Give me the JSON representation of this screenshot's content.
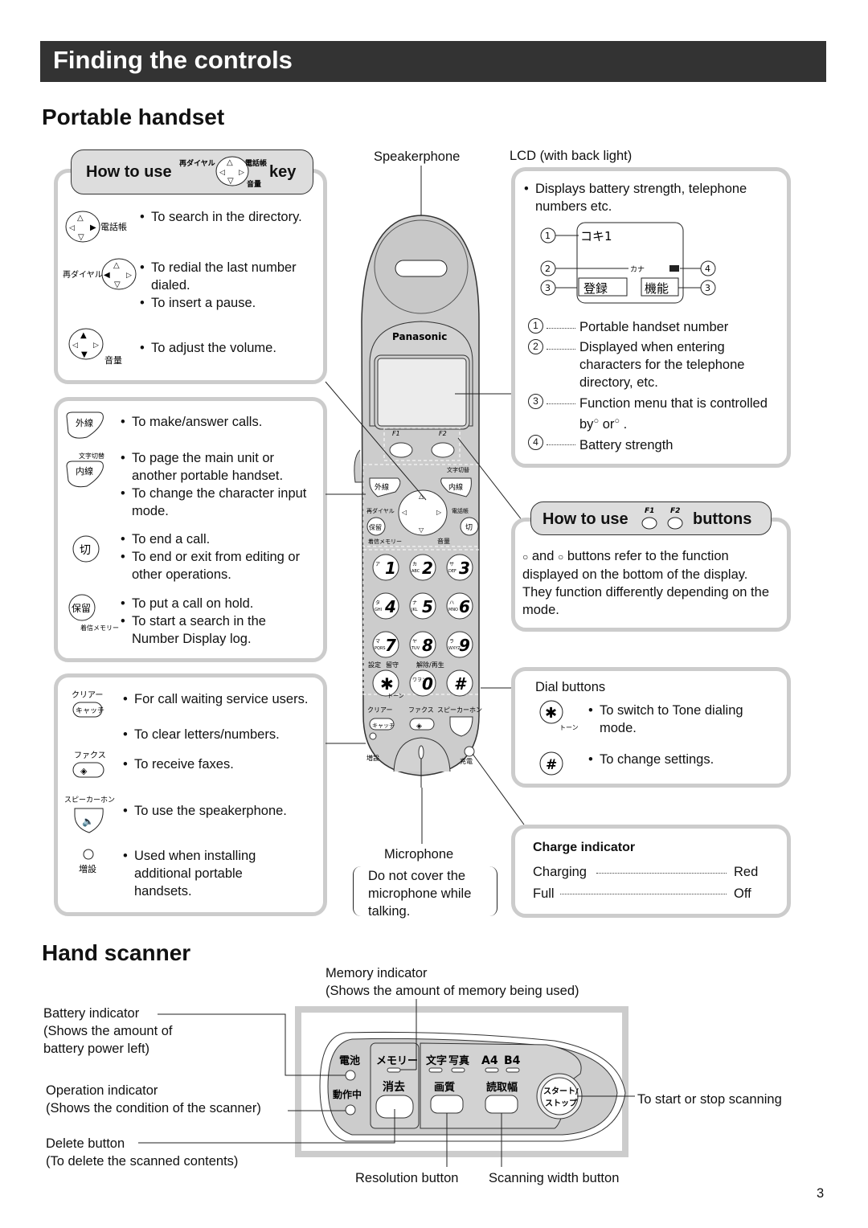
{
  "page": {
    "title": "Finding the controls",
    "page_number": "3",
    "colors": {
      "banner": "#333333",
      "box_border": "#cccccc",
      "pill_bg": "#dddddd"
    }
  },
  "handset": {
    "heading": "Portable handset",
    "nav_key_box": {
      "title_pre": "How to use",
      "title_post": "key",
      "key_labels": {
        "redial": "再ダイヤル",
        "directory": "電話帳",
        "volume": "音量"
      },
      "items": [
        {
          "icon": "nav-key-right-icon",
          "icon_label": "電話帳",
          "bullets": [
            "To search in the directory."
          ]
        },
        {
          "icon": "nav-key-left-icon",
          "icon_label": "再ダイヤル",
          "bullets": [
            "To redial the last number dialed.",
            "To insert a pause."
          ]
        },
        {
          "icon": "nav-key-updown-icon",
          "icon_label": "音量",
          "bullets": [
            "To adjust the volume."
          ]
        }
      ]
    },
    "call_box": {
      "items": [
        {
          "icon": "outside-line-button-icon",
          "icon_label": "外線",
          "icon_sub": "",
          "bullets": [
            "To make/answer calls."
          ]
        },
        {
          "icon": "intercom-button-icon",
          "icon_label": "内線",
          "icon_sub": "文字切替",
          "bullets": [
            "To page the main unit or another portable handset.",
            "To change the character input mode."
          ]
        },
        {
          "icon": "off-button-icon",
          "icon_label": "切",
          "icon_sub": "",
          "bullets": [
            "To end a call.",
            "To end or exit from editing or other operations."
          ]
        },
        {
          "icon": "hold-button-icon",
          "icon_label": "保留",
          "icon_sub": "着信メモリー",
          "bullets": [
            "To put a call on hold.",
            "To start a search in the Number Display log."
          ]
        }
      ]
    },
    "misc_box": {
      "items": [
        {
          "icon": "catch-button-icon",
          "icon_label": "キャッチ",
          "icon_sub": "クリアー",
          "bullets": [
            "For call waiting service users.",
            "To clear letters/numbers."
          ]
        },
        {
          "icon": "fax-button-icon",
          "icon_label": "",
          "icon_sub": "ファクス",
          "bullets": [
            "To receive faxes."
          ]
        },
        {
          "icon": "speakerphone-button-icon",
          "icon_label": "",
          "icon_sub": "スピーカーホン",
          "bullets": [
            "To use the speakerphone."
          ]
        },
        {
          "icon": "add-handset-button-icon",
          "icon_label": "増設",
          "icon_sub": "",
          "bullets": [
            "Used when installing additional portable handsets."
          ]
        }
      ]
    },
    "callouts": {
      "speakerphone": "Speakerphone",
      "lcd": "LCD (with back light)",
      "microphone": "Microphone",
      "microphone_note": "Do not cover the microphone while talking."
    },
    "phone": {
      "brand": "Panasonic",
      "f1": "F1",
      "f2": "F2",
      "labels": {
        "char_switch": "文字切替",
        "outside": "外線",
        "intercom": "内線",
        "redial": "再ダイヤル",
        "directory": "電話帳",
        "hold": "保留",
        "off": "切",
        "memory": "着信メモリー",
        "volume": "音量",
        "setting": "設定",
        "answer": "留守",
        "release": "解除/再生",
        "tone": "トーン",
        "clear": "クリアー",
        "fax": "ファクス",
        "speaker": "スピーカーホン",
        "catch": "キャッチ",
        "add": "増設",
        "charge": "充電"
      },
      "keys": [
        {
          "digit": "1",
          "kana": "ア",
          "letters": ""
        },
        {
          "digit": "2",
          "kana": "カ",
          "letters": "ABC"
        },
        {
          "digit": "3",
          "kana": "サ",
          "letters": "DEF"
        },
        {
          "digit": "4",
          "kana": "タ",
          "letters": "GHI"
        },
        {
          "digit": "5",
          "kana": "ナ",
          "letters": "JKL"
        },
        {
          "digit": "6",
          "kana": "ハ",
          "letters": "MNO"
        },
        {
          "digit": "7",
          "kana": "マ",
          "letters": "PQRS"
        },
        {
          "digit": "8",
          "kana": "ヤ",
          "letters": "TUV"
        },
        {
          "digit": "9",
          "kana": "ラ",
          "letters": "WXYZ"
        },
        {
          "digit": "✱",
          "kana": "",
          "letters": ""
        },
        {
          "digit": "0",
          "kana": "ワヲン",
          "letters": ""
        },
        {
          "digit": "#",
          "kana": "",
          "letters": ""
        }
      ]
    },
    "lcd_box": {
      "bullet": "Displays battery strength, telephone numbers etc.",
      "screen": {
        "line1": "コキ1",
        "kana": "カナ",
        "soft_left": "登録",
        "soft_right": "機能"
      },
      "legend": [
        {
          "n": "1",
          "text": "Portable handset number"
        },
        {
          "n": "2",
          "text": "Displayed when entering characters for the telephone directory, etc."
        },
        {
          "n": "3",
          "text_pre": "Function menu that is controlled by",
          "text_or": "or",
          "text_post": "."
        },
        {
          "n": "4",
          "text": "Battery strength"
        }
      ]
    },
    "f_box": {
      "title_pre": "How to use",
      "title_post": "buttons",
      "f1": "F1",
      "f2": "F2",
      "text_and": "and",
      "text": "buttons refer to the function displayed on the bottom of the display. They function differently depending on the mode."
    },
    "dial_box": {
      "title": "Dial buttons",
      "items": [
        {
          "icon": "star-key-icon",
          "glyph": "✱",
          "sub": "トーン",
          "text": "To switch to Tone dialing mode."
        },
        {
          "icon": "hash-key-icon",
          "glyph": "#",
          "sub": "",
          "text": "To change settings."
        }
      ]
    },
    "charge_box": {
      "title": "Charge indicator",
      "rows": [
        {
          "state": "Charging",
          "value": "Red"
        },
        {
          "state": "Full",
          "value": "Off"
        }
      ]
    }
  },
  "scanner": {
    "heading": "Hand scanner",
    "callouts": {
      "memory_title": "Memory indicator",
      "memory_desc": "(Shows the amount of memory being used)",
      "battery_title": "Battery indicator",
      "battery_desc": "(Shows the amount of battery power left)",
      "operation_title": "Operation indicator",
      "operation_desc": "(Shows the condition of the scanner)",
      "delete_title": "Delete button",
      "delete_desc": "(To delete the scanned contents)",
      "startstop": "To start or stop scanning",
      "resolution": "Resolution button",
      "width": "Scanning width button"
    },
    "panel": {
      "battery": "電池",
      "operating": "動作中",
      "memory": "メモリー",
      "delete": "消去",
      "text": "文字",
      "photo": "写真",
      "a4": "A4",
      "b4": "B4",
      "quality": "画質",
      "width": "読取幅",
      "start1": "スタート/",
      "start2": "ストップ"
    }
  }
}
